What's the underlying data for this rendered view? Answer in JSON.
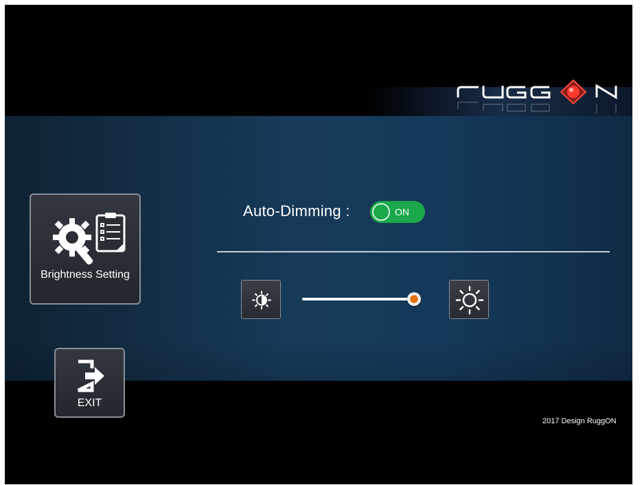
{
  "brand": {
    "logo_text": "RUGGON"
  },
  "settings_tile": {
    "label": "Brightness Setting",
    "icon": "gear-wrench-checklist-icon"
  },
  "exit_tile": {
    "label": "EXIT",
    "icon": "exit-door-icon"
  },
  "auto_dimming": {
    "label": "Auto-Dimming :",
    "state": "ON"
  },
  "brightness": {
    "decrease_icon": "brightness-low-icon",
    "increase_icon": "brightness-high-icon",
    "level_fraction": 1.0
  },
  "footer": {
    "copyright": "2017 Design RuggON"
  },
  "colors": {
    "toggle_on": "#1aa84a",
    "slider_thumb": "#f07a10",
    "panel": "#163a58"
  }
}
